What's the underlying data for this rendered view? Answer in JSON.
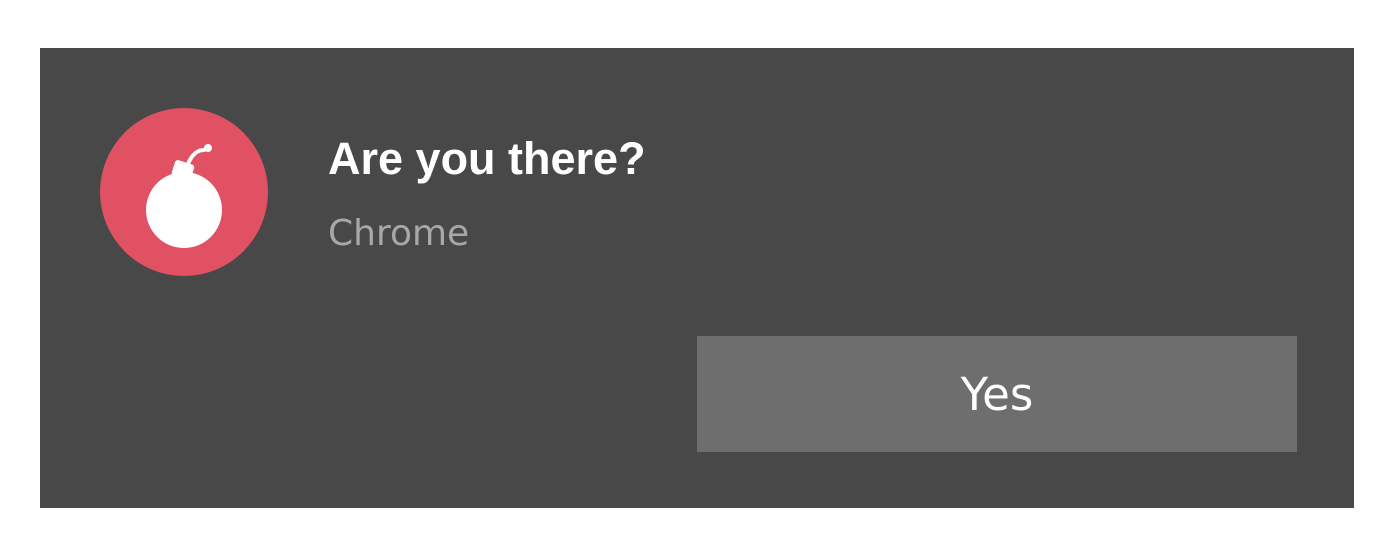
{
  "notification": {
    "icon": "bomb-icon",
    "icon_bg_color": "#e05263",
    "background_color": "#484848",
    "title": "Are you there?",
    "source": "Chrome",
    "actions": [
      {
        "label": "Yes"
      }
    ]
  }
}
